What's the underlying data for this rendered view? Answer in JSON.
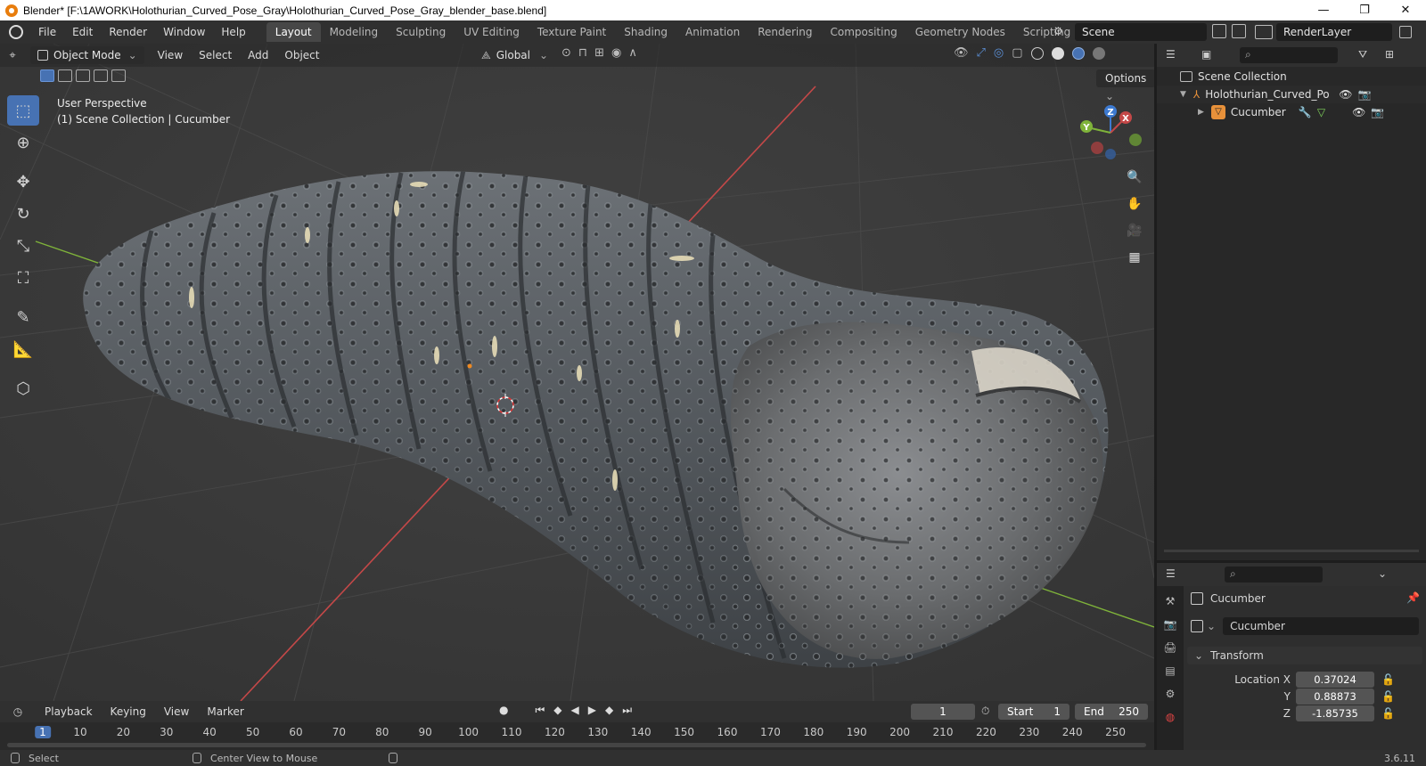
{
  "window": {
    "title": "Blender* [F:\\1AWORK\\Holothurian_Curved_Pose_Gray\\Holothurian_Curved_Pose_Gray_blender_base.blend]",
    "minimize": "—",
    "maximize": "❐",
    "close": "✕"
  },
  "menu": [
    "File",
    "Edit",
    "Render",
    "Window",
    "Help"
  ],
  "workspaces": [
    "Layout",
    "Modeling",
    "Sculpting",
    "UV Editing",
    "Texture Paint",
    "Shading",
    "Animation",
    "Rendering",
    "Compositing",
    "Geometry Nodes",
    "Scripting"
  ],
  "workspace_add": "+",
  "scene": {
    "name": "Scene"
  },
  "render_layer": {
    "name": "RenderLayer"
  },
  "viewport": {
    "mode": "Object Mode",
    "menus": [
      "View",
      "Select",
      "Add",
      "Object"
    ],
    "orientation": "Global",
    "options_label": "Options",
    "view_name": "User Perspective",
    "collection_info": "(1) Scene Collection | Cucumber",
    "gizmo_labels": {
      "z": "Z",
      "y": "Y",
      "x": "X"
    }
  },
  "outliner": {
    "root": "Scene Collection",
    "items": [
      {
        "name": "Holothurian_Curved_Pose_Gr"
      },
      {
        "name": "Cucumber"
      }
    ]
  },
  "properties": {
    "object_name": "Cucumber",
    "data_name": "Cucumber",
    "panel": "Transform",
    "location_label": "Location X",
    "y_label": "Y",
    "z_label": "Z",
    "location": {
      "x": "0.37024",
      "y": "0.88873",
      "z": "-1.85735"
    }
  },
  "timeline": {
    "menus": [
      "Playback",
      "Keying",
      "View",
      "Marker"
    ],
    "current_frame": "1",
    "start_label": "Start",
    "start": "1",
    "end_label": "End",
    "end": "250",
    "ruler": [
      "1",
      "10",
      "20",
      "30",
      "40",
      "50",
      "60",
      "70",
      "80",
      "90",
      "100",
      "110",
      "120",
      "130",
      "140",
      "150",
      "160",
      "170",
      "180",
      "190",
      "200",
      "210",
      "220",
      "230",
      "240",
      "250"
    ]
  },
  "status": {
    "select": "Select",
    "center_view": "Center View to Mouse",
    "version": "3.6.11"
  },
  "colors": {
    "accent": "#4772b3",
    "x_axis": "#c44848",
    "y_axis": "#7fb33a",
    "z_axis": "#3d7ad1"
  }
}
